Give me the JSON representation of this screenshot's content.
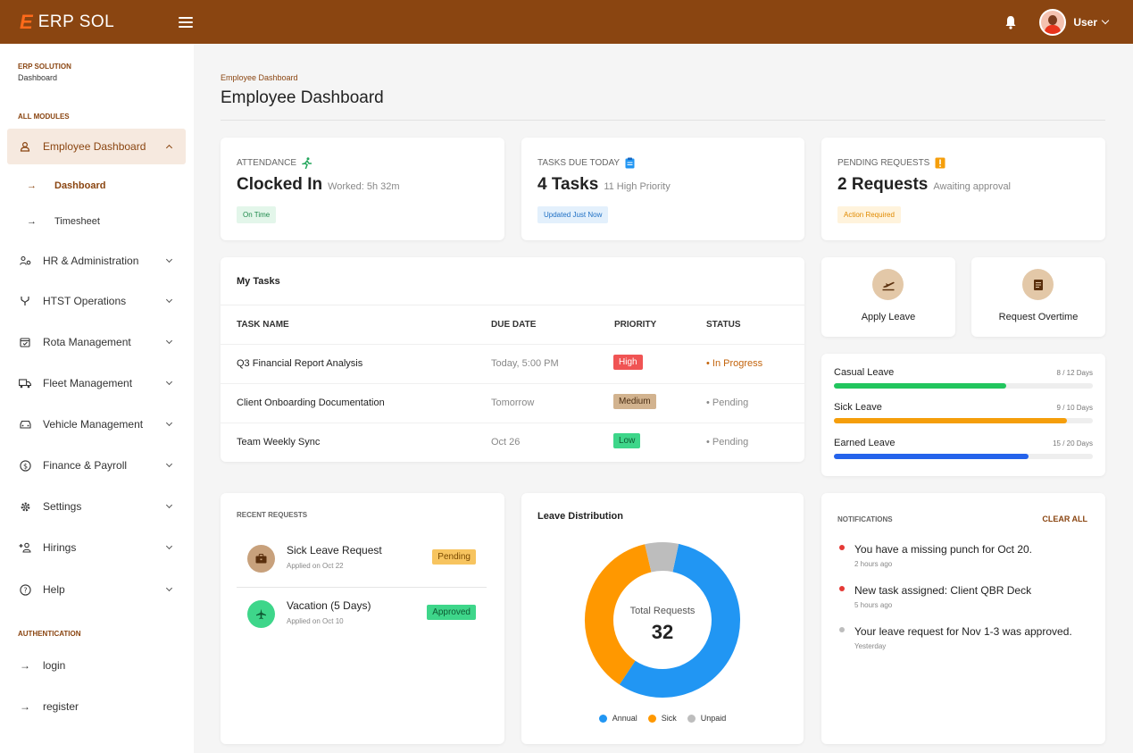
{
  "header": {
    "brand_mark": "E",
    "brand_name": "ERP SOL",
    "user_name": "User"
  },
  "sidebar": {
    "app_name": "ERP SOLUTION",
    "app_sub": "Dashboard",
    "section_modules": "ALL MODULES",
    "items": [
      {
        "label": "Employee Dashboard",
        "icon": "user-icon"
      },
      {
        "label": "HR & Administration",
        "icon": "users-cog-icon"
      },
      {
        "label": "HTST Operations",
        "icon": "fork-icon"
      },
      {
        "label": "Rota Management",
        "icon": "calendar-icon"
      },
      {
        "label": "Fleet Management",
        "icon": "truck-icon"
      },
      {
        "label": "Vehicle Management",
        "icon": "car-icon"
      },
      {
        "label": "Finance & Payroll",
        "icon": "dollar-icon"
      },
      {
        "label": "Settings",
        "icon": "gear-icon"
      },
      {
        "label": "Hirings",
        "icon": "user-plus-icon"
      },
      {
        "label": "Help",
        "icon": "help-icon"
      }
    ],
    "subitems": [
      {
        "label": "Dashboard"
      },
      {
        "label": "Timesheet"
      }
    ],
    "section_auth": "AUTHENTICATION",
    "auth_items": [
      {
        "label": "login"
      },
      {
        "label": "register"
      }
    ]
  },
  "page": {
    "breadcrumb": "Employee Dashboard",
    "title": "Employee Dashboard"
  },
  "stats": [
    {
      "label": "ATTENDANCE",
      "value": "Clocked In",
      "sub": "Worked: 5h 32m",
      "pill": "On Time",
      "icon": "running-icon"
    },
    {
      "label": "TASKS DUE TODAY",
      "value": "4 Tasks",
      "sub": "11 High Priority",
      "pill": "Updated Just Now",
      "icon": "clipboard-icon"
    },
    {
      "label": "PENDING REQUESTS",
      "value": "2 Requests",
      "sub": "Awaiting approval",
      "pill": "Action Required",
      "icon": "alert-icon"
    }
  ],
  "tasks": {
    "title": "My Tasks",
    "headers": [
      "TASK NAME",
      "DUE DATE",
      "PRIORITY",
      "STATUS"
    ],
    "rows": [
      {
        "name": "Q3 Financial Report Analysis",
        "due": "Today, 5:00 PM",
        "priority": "High",
        "status": "• In Progress"
      },
      {
        "name": "Client Onboarding Documentation",
        "due": "Tomorrow",
        "priority": "Medium",
        "status": "• Pending"
      },
      {
        "name": "Team Weekly Sync",
        "due": "Oct 26",
        "priority": "Low",
        "status": "• Pending"
      }
    ]
  },
  "actions": [
    {
      "label": "Apply Leave",
      "icon": "plane-icon"
    },
    {
      "label": "Request Overtime",
      "icon": "document-icon"
    }
  ],
  "leave_balance": [
    {
      "name": "Casual Leave",
      "value": "8 / 12 Days",
      "used": 8,
      "total": 12,
      "color": "#22c55e"
    },
    {
      "name": "Sick Leave",
      "value": "9 / 10 Days",
      "used": 9,
      "total": 10,
      "color": "#f59e0b"
    },
    {
      "name": "Earned Leave",
      "value": "15 / 20 Days",
      "used": 15,
      "total": 20,
      "color": "#2563eb"
    }
  ],
  "recent_requests": {
    "title": "RECENT REQUESTS",
    "items": [
      {
        "title": "Sick Leave Request",
        "sub": "Applied on Oct 22",
        "status": "Pending",
        "icon": "briefcase-icon"
      },
      {
        "title": "Vacation (5 Days)",
        "sub": "Applied on Oct 10",
        "status": "Approved",
        "icon": "plane-icon"
      }
    ]
  },
  "leave_distribution": {
    "title": "Leave Distribution",
    "center_label": "Total Requests",
    "center_value": "32"
  },
  "chart_data": {
    "type": "pie",
    "title": "Leave Distribution",
    "categories": [
      "Annual",
      "Sick",
      "Unpaid"
    ],
    "values": [
      56,
      37,
      7
    ],
    "colors": [
      "#2196f3",
      "#ff9800",
      "#bdbdbd"
    ]
  },
  "notifications": {
    "title": "NOTIFICATIONS",
    "clear_label": "CLEAR ALL",
    "items": [
      {
        "text": "You have a missing punch for Oct 20.",
        "time": "2 hours ago",
        "color": "#e53935"
      },
      {
        "text": "New task assigned: Client QBR Deck",
        "time": "5 hours ago",
        "color": "#e53935"
      },
      {
        "text": "Your leave request for Nov 1-3 was approved.",
        "time": "Yesterday",
        "color": "#bdbdbd"
      }
    ]
  }
}
